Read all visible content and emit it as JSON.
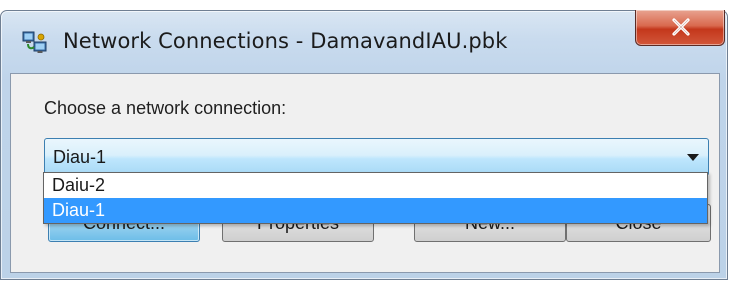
{
  "window": {
    "title": "Network Connections - DamavandIAU.pbk",
    "app_icon": "network-connections-icon",
    "close_icon": "close-x-icon",
    "colors": {
      "frame": "#bfd4ea",
      "close_button": "#c4381c",
      "selection": "#3399ff",
      "combo_border": "#3c7fb1"
    }
  },
  "dialog": {
    "prompt": "Choose a network connection:",
    "combo": {
      "selected": "Diau-1",
      "arrow_icon": "chevron-down-icon"
    },
    "dropdown": {
      "items": [
        {
          "label": "Daiu-2",
          "selected": false
        },
        {
          "label": "Diau-1",
          "selected": true
        }
      ]
    },
    "buttons": {
      "connect": "Connect...",
      "properties": "Properties",
      "new": "New...",
      "close": "Close"
    }
  }
}
